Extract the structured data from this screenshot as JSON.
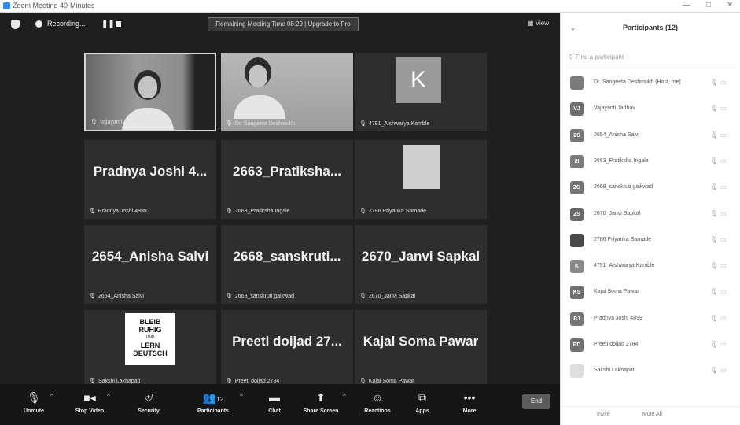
{
  "window": {
    "title": "Zoom Meeting 40-Minutes",
    "controls": [
      "—",
      "□",
      "✕"
    ]
  },
  "topbar": {
    "recording_label": "Recording...",
    "pause_icon": "❚❚",
    "remaining_banner": "Remaining Meeting Time 08:29 | Upgrade to Pro",
    "view_label": "View"
  },
  "tiles": [
    {
      "kind": "video",
      "display": "",
      "label": "Vajayanti Jadhav",
      "active": true
    },
    {
      "kind": "video2",
      "display": "",
      "label": "Dr. Sangeeta Deshmukh",
      "active": false
    },
    {
      "kind": "initial",
      "display": "K",
      "label": "4791_Aishwarya Kamble",
      "active": false
    },
    {
      "kind": "name",
      "display": "Pradnya Joshi 4...",
      "label": "Pradnya Joshi 4899",
      "active": false
    },
    {
      "kind": "name",
      "display": "2663_Pratiksha...",
      "label": "2663_Pratiksha Ingale",
      "active": false
    },
    {
      "kind": "photo",
      "display": "",
      "label": "2786 Priyanka Sarnade",
      "active": false
    },
    {
      "kind": "name",
      "display": "2654_Anisha Salvi",
      "label": "2654_Anisha Salvi",
      "active": false
    },
    {
      "kind": "name",
      "display": "2668_sanskruti...",
      "label": "2668_sanskruti gaikwad",
      "active": false
    },
    {
      "kind": "name",
      "display": "2670_Janvi Sapkal",
      "label": "2670_Janvi Sapkal",
      "active": false
    },
    {
      "kind": "book",
      "display": "",
      "label": "Sakshi Lakhapati",
      "active": false
    },
    {
      "kind": "name",
      "display": "Preeti doijad 27...",
      "label": "Preeti doijad 2784",
      "active": false
    },
    {
      "kind": "name",
      "display": "Kajal Soma Pawar",
      "label": "Kajal Soma Pawar",
      "active": false
    }
  ],
  "book_avatar_text": {
    "line1": "BLEIB",
    "line2": "RUHIG",
    "line3": "UND",
    "line4": "LERN",
    "line5": "DEUTSCH"
  },
  "toolbar": {
    "unmute": "Unmute",
    "stop_video": "Stop Video",
    "security": "Security",
    "participants": "Participants",
    "participants_count": "12",
    "chat": "Chat",
    "share_screen": "Share Screen",
    "reactions": "Reactions",
    "apps": "Apps",
    "more": "More",
    "end": "End"
  },
  "panel": {
    "title": "Participants (12)",
    "search_placeholder": "Find a participant",
    "participants": [
      {
        "initials": "",
        "name": "Dr. Sangeeta Deshmukh (Host, me)",
        "avatar_color": "#7a7a7a"
      },
      {
        "initials": "VJ",
        "name": "Vajayanti Jadhav",
        "avatar_color": "#6e6e6e"
      },
      {
        "initials": "2S",
        "name": "2654_Anisha Salvi",
        "avatar_color": "#777777"
      },
      {
        "initials": "2I",
        "name": "2663_Pratiksha Ingale",
        "avatar_color": "#7c7c7c"
      },
      {
        "initials": "2G",
        "name": "2668_sanskruti gaikwad",
        "avatar_color": "#747474"
      },
      {
        "initials": "2S",
        "name": "2670_Janvi Sapkal",
        "avatar_color": "#6a6a6a"
      },
      {
        "initials": "",
        "name": "2786 Priyanka Sarnade",
        "avatar_color": "#4a4a4a"
      },
      {
        "initials": "K",
        "name": "4791_Aishwarya Kamble",
        "avatar_color": "#8a8a8a"
      },
      {
        "initials": "KS",
        "name": "Kajal Soma Pawar",
        "avatar_color": "#707070"
      },
      {
        "initials": "PJ",
        "name": "Pradnya Joshi 4899",
        "avatar_color": "#767676"
      },
      {
        "initials": "PD",
        "name": "Preeti doijad 2784",
        "avatar_color": "#6f6f6f"
      },
      {
        "initials": "",
        "name": "Sakshi Lakhapati",
        "avatar_color": "#dddddd"
      }
    ],
    "footer_invite": "Invite",
    "footer_mute": "Mute All"
  }
}
